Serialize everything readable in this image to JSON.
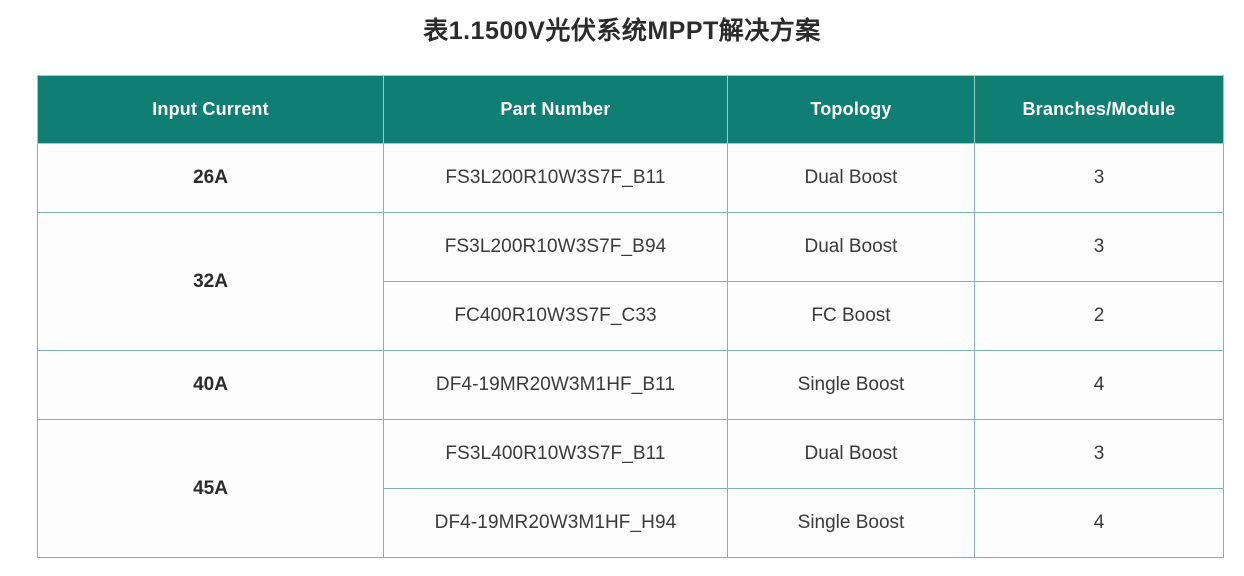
{
  "title": "表1.1500V光伏系统MPPT解决方案",
  "colors": {
    "header_bg": "#0f7f73",
    "header_text": "#ffffff",
    "border": "#7fb3ab",
    "cell_bg": "#fdfdfd",
    "title_text": "#2b2b2b",
    "cell_text": "#3a3a3a"
  },
  "table": {
    "headers": [
      "Input Current",
      "Part Number",
      "Topology",
      "Branches/Module"
    ],
    "groups": [
      {
        "input_current": "26A",
        "rowspan": 1,
        "rows": [
          {
            "part_number": "FS3L200R10W3S7F_B11",
            "topology": "Dual Boost",
            "branches": "3"
          }
        ]
      },
      {
        "input_current": "32A",
        "rowspan": 2,
        "rows": [
          {
            "part_number": "FS3L200R10W3S7F_B94",
            "topology": "Dual Boost",
            "branches": "3"
          },
          {
            "part_number": "FC400R10W3S7F_C33",
            "topology": "FC Boost",
            "branches": "2"
          }
        ]
      },
      {
        "input_current": "40A",
        "rowspan": 1,
        "rows": [
          {
            "part_number": "DF4-19MR20W3M1HF_B11",
            "topology": "Single Boost",
            "branches": "4"
          }
        ]
      },
      {
        "input_current": "45A",
        "rowspan": 2,
        "rows": [
          {
            "part_number": "FS3L400R10W3S7F_B11",
            "topology": "Dual Boost",
            "branches": "3"
          },
          {
            "part_number": "DF4-19MR20W3M1HF_H94",
            "topology": "Single Boost",
            "branches": "4"
          }
        ]
      }
    ]
  }
}
